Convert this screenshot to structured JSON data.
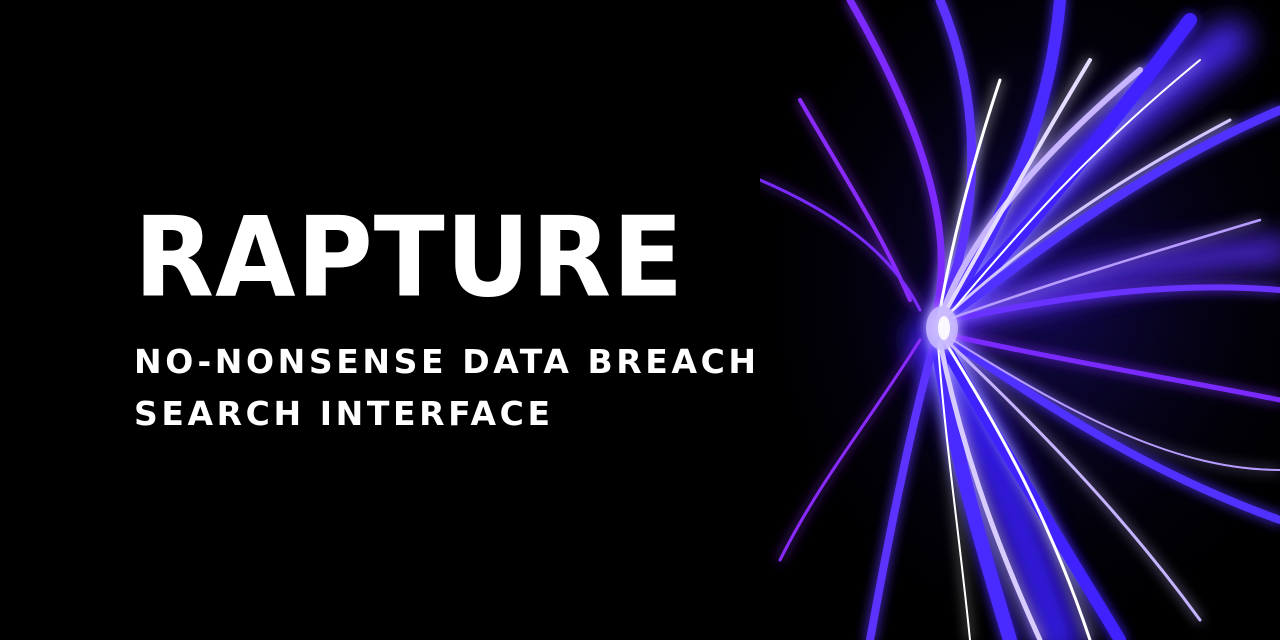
{
  "banner": {
    "title": "RAPTURE",
    "subtitle_line1": "NO-NONSENSE DATA BREACH",
    "subtitle_line2": "SEARCH INTERFACE",
    "background_color": "#000000",
    "text_color": "#ffffff",
    "accent_colors": [
      "#3b1cff",
      "#7a2cff",
      "#b08cff",
      "#ffffff"
    ],
    "artwork": "light-painting-icon"
  }
}
